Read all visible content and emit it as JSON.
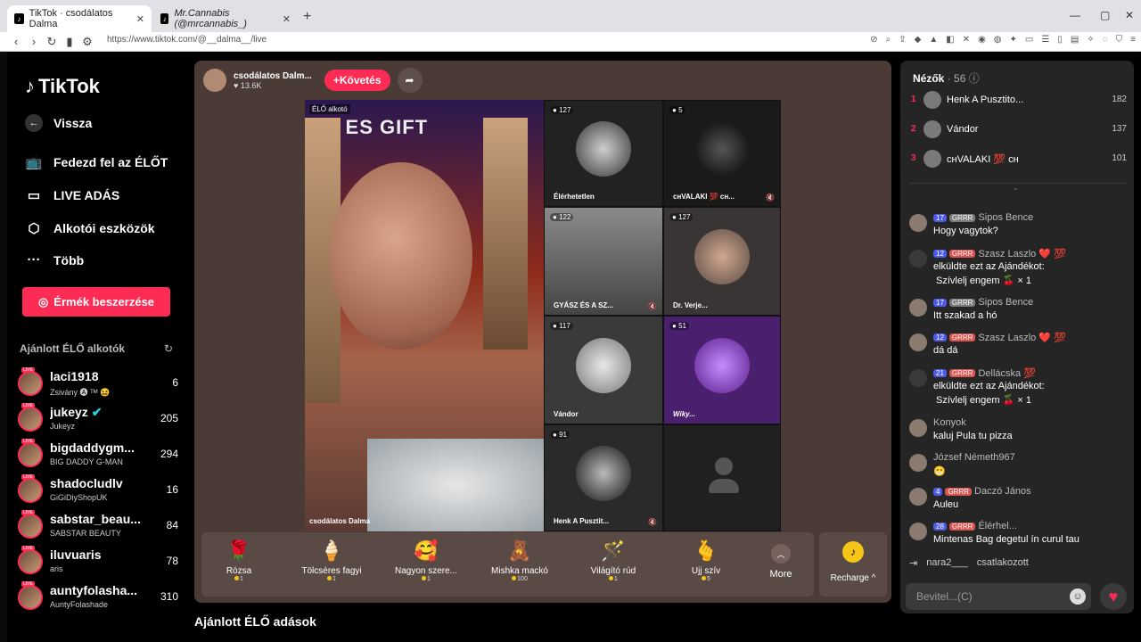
{
  "browser": {
    "tabs": [
      {
        "title": "TikTok · csodálatos Dalma"
      },
      {
        "title": "Mr.Cannabis (@mrcannabis_)"
      }
    ],
    "new_tab": "+",
    "url": "https://www.tiktok.com/@__dalma__/live"
  },
  "sidebar": {
    "logo": "TikTok",
    "nav": [
      {
        "label": "Vissza",
        "icon": "back-arrow-icon"
      },
      {
        "label": "Fedezd fel az ÉLŐT",
        "icon": "live-tv-icon"
      },
      {
        "label": "LIVE ADÁS",
        "icon": "camera-icon"
      },
      {
        "label": "Alkotói eszközök",
        "icon": "creator-tools-icon"
      },
      {
        "label": "Több",
        "icon": "more-icon"
      }
    ],
    "coins_button": "Érmék beszerzése",
    "recommended_title": "Ajánlott ÉLŐ alkotók",
    "creators": [
      {
        "name": "laci1918",
        "sub": "Zsivány 🅐 ᵀᴹ 😆",
        "count": "6"
      },
      {
        "name": "jukeyz",
        "sub": "Jukeyz",
        "count": "205"
      },
      {
        "name": "bigdaddygm...",
        "sub": "BIG DADDY G-MAN",
        "count": "294"
      },
      {
        "name": "shadocludlv",
        "sub": "GiGiDiyShopUK",
        "count": "16"
      },
      {
        "name": "sabstar_beau...",
        "sub": "SABSTAR BEAUTY",
        "count": "84"
      },
      {
        "name": "iluvuaris",
        "sub": "aris",
        "count": "78"
      },
      {
        "name": "auntyfolasha...",
        "sub": "AuntyFolashade",
        "count": "310"
      }
    ]
  },
  "stream": {
    "host_name": "csodálatos Dalm...",
    "host_likes": "13.6K",
    "follow_label": "+Követés",
    "live_label": "ÉLŐ alkotó",
    "bg_text": "TIK  ES GIFT",
    "host_label": "csodálatos Dalma",
    "guests": [
      {
        "count": "127",
        "label": "Élérhetetlen"
      },
      {
        "count": "5",
        "label": "ᴄʜVALAKI 💯 ᴄʜ..."
      },
      {
        "count": "122",
        "label": "GYÁSZ ÉS A SZ..."
      },
      {
        "count": "127",
        "label": "Dr. Verje..."
      },
      {
        "count": "117",
        "label": "Vándor"
      },
      {
        "count": "51",
        "label": "Wiky..."
      },
      {
        "count": "91",
        "label": "Henk A Pusztit..."
      }
    ]
  },
  "gifts": [
    {
      "name": "Rózsa",
      "price": "1",
      "icon": "🌹"
    },
    {
      "name": "Tölcséres fagyi",
      "price": "1",
      "icon": "🍦"
    },
    {
      "name": "Nagyon szere...",
      "price": "1",
      "icon": "🥰"
    },
    {
      "name": "Mishka mackó",
      "price": "100",
      "icon": "🧸"
    },
    {
      "name": "Világító rúd",
      "price": "1",
      "icon": "🪄"
    },
    {
      "name": "Ujj szív",
      "price": "5",
      "icon": "🫰"
    }
  ],
  "more_label": "More",
  "recharge_label": "Recharge",
  "recommended_live_title": "Ajánlott ÉLŐ adások",
  "viewers": {
    "title": "Nézők",
    "count": "· 56",
    "top": [
      {
        "rank": "1",
        "name": "Henk A Pusztito...",
        "score": "182"
      },
      {
        "rank": "2",
        "name": "Vándor",
        "score": "137"
      },
      {
        "rank": "3",
        "name": "ᴄʜVALAKI 💯 ᴄʜ",
        "score": "101"
      }
    ]
  },
  "chat": [
    {
      "level": "17",
      "fan": "GRRR",
      "user": "Sipos Bence",
      "text": "Hogy vagytok?"
    },
    {
      "level": "12",
      "fan": "GRRR",
      "user": "Szasz Laszlo ❤️ 💯",
      "text": "elküldte ezt az Ajándékot:",
      "text2": "Szívlelj engem 🍒 × 1"
    },
    {
      "level": "17",
      "fan": "GRRR",
      "user": "Sipos Bence",
      "text": "Itt szakad a hó"
    },
    {
      "level": "12",
      "fan": "GRRR",
      "user": "Szasz Laszlo ❤️ 💯",
      "text": "dá dá"
    },
    {
      "level": "21",
      "fan": "GRRR",
      "user": "Dellácska 💯",
      "text": "elküldte ezt az Ajándékot:",
      "text2": "Szívlelj engem 🍒 × 1"
    },
    {
      "level": "",
      "fan": "",
      "user": "Konyok",
      "text": "kaluj Pula tu pizza"
    },
    {
      "level": "",
      "fan": "",
      "user": "József Németh967",
      "text": "😁"
    },
    {
      "level": "4",
      "fan": "GRRR",
      "user": "Daczó János",
      "text": "Auleu"
    },
    {
      "level": "28",
      "fan": "GRRR",
      "user": "Élérhel...",
      "text": "Mintenas Bag degetul ín curul tau"
    }
  ],
  "joined": {
    "user": "nara2___",
    "action": "csatlakozott"
  },
  "input_placeholder": "Bevitel...(C)"
}
